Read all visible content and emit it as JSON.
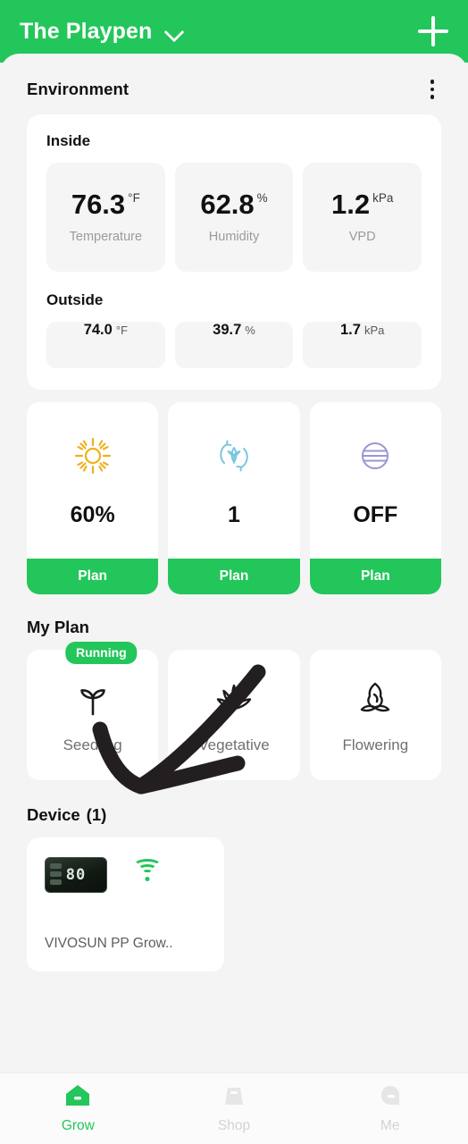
{
  "header": {
    "title": "The Playpen",
    "dropdown_icon": "chevron-down-icon",
    "add_icon": "plus-icon"
  },
  "environment": {
    "title": "Environment",
    "menu_icon": "kebab-menu-icon",
    "inside": {
      "label": "Inside",
      "tiles": [
        {
          "value": "76.3",
          "unit": "°F",
          "label": "Temperature"
        },
        {
          "value": "62.8",
          "unit": "%",
          "label": "Humidity"
        },
        {
          "value": "1.2",
          "unit": "kPa",
          "label": "VPD"
        }
      ]
    },
    "outside": {
      "label": "Outside",
      "tiles": [
        {
          "value": "74.0",
          "unit": "°F"
        },
        {
          "value": "39.7",
          "unit": "%"
        },
        {
          "value": "1.7",
          "unit": "kPa"
        }
      ]
    }
  },
  "controls": [
    {
      "icon": "sun-icon",
      "icon_color": "#eeb11e",
      "value": "60%",
      "button": "Plan"
    },
    {
      "icon": "circulation-leaf-icon",
      "icon_color": "#7cc6e0",
      "value": "1",
      "button": "Plan"
    },
    {
      "icon": "humidity-lines-icon",
      "icon_color": "#9a96d4",
      "value": "OFF",
      "button": "Plan"
    }
  ],
  "my_plan": {
    "title": "My Plan",
    "cards": [
      {
        "icon": "seedling-icon",
        "label": "Seedling",
        "badge": "Running"
      },
      {
        "icon": "cannabis-leaf-icon",
        "label": "Vegetative",
        "badge": ""
      },
      {
        "icon": "flower-bud-icon",
        "label": "Flowering",
        "badge": ""
      }
    ]
  },
  "devices": {
    "title": "Device",
    "count": "(1)",
    "items": [
      {
        "name": "VIVOSUN PP Grow..",
        "display_value": "80",
        "status_icon": "wifi-icon",
        "status_color": "#23c65a"
      }
    ]
  },
  "tabbar": [
    {
      "icon": "home-icon",
      "label": "Grow",
      "active": true
    },
    {
      "icon": "shop-bag-icon",
      "label": "Shop",
      "active": false
    },
    {
      "icon": "profile-icon",
      "label": "Me",
      "active": false
    }
  ],
  "annotation": {
    "type": "hand-drawn-arrow",
    "color": "#231f20",
    "points_to": "Seedling"
  },
  "colors": {
    "brand_green": "#23c65a",
    "page_background": "#f4f4f4",
    "card_background": "#ffffff"
  }
}
